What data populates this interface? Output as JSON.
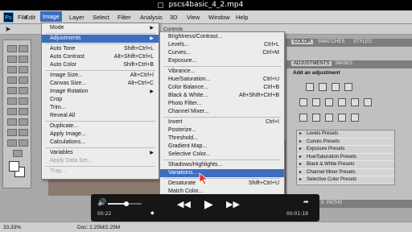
{
  "window": {
    "title": "pscs4basic_4_2.mp4"
  },
  "app": {
    "logo": "Ps"
  },
  "menubar": {
    "items": [
      "File",
      "Edit",
      "Image",
      "Layer",
      "Select",
      "Filter",
      "Analysis",
      "3D",
      "View",
      "Window",
      "Help"
    ],
    "active": "Image"
  },
  "optionsbar": {
    "controls_label": "Controls"
  },
  "image_menu": [
    {
      "label": "Mode",
      "type": "submenu"
    },
    {
      "type": "separator"
    },
    {
      "label": "Adjustments",
      "type": "submenu",
      "highlighted": true
    },
    {
      "type": "separator"
    },
    {
      "label": "Auto Tone",
      "shortcut": "Shift+Ctrl+L"
    },
    {
      "label": "Auto Contrast",
      "shortcut": "Alt+Shift+Ctrl+L"
    },
    {
      "label": "Auto Color",
      "shortcut": "Shift+Ctrl+B"
    },
    {
      "type": "separator"
    },
    {
      "label": "Image Size...",
      "shortcut": "Alt+Ctrl+I"
    },
    {
      "label": "Canvas Size...",
      "shortcut": "Alt+Ctrl+C"
    },
    {
      "label": "Image Rotation",
      "type": "submenu"
    },
    {
      "label": "Crop"
    },
    {
      "label": "Trim..."
    },
    {
      "label": "Reveal All"
    },
    {
      "type": "separator"
    },
    {
      "label": "Duplicate..."
    },
    {
      "label": "Apply Image..."
    },
    {
      "label": "Calculations..."
    },
    {
      "type": "separator"
    },
    {
      "label": "Variables",
      "type": "submenu"
    },
    {
      "label": "Apply Data Set...",
      "disabled": true
    },
    {
      "type": "separator"
    },
    {
      "label": "Trap...",
      "disabled": true
    }
  ],
  "adjustments_menu": [
    {
      "label": "Brightness/Contrast..."
    },
    {
      "label": "Levels...",
      "shortcut": "Ctrl+L"
    },
    {
      "label": "Curves...",
      "shortcut": "Ctrl+M"
    },
    {
      "label": "Exposure..."
    },
    {
      "type": "separator"
    },
    {
      "label": "Vibrance..."
    },
    {
      "label": "Hue/Saturation...",
      "shortcut": "Ctrl+U"
    },
    {
      "label": "Color Balance...",
      "shortcut": "Ctrl+B"
    },
    {
      "label": "Black & White...",
      "shortcut": "Alt+Shift+Ctrl+B"
    },
    {
      "label": "Photo Filter..."
    },
    {
      "label": "Channel Mixer..."
    },
    {
      "type": "separator"
    },
    {
      "label": "Invert",
      "shortcut": "Ctrl+I"
    },
    {
      "label": "Posterize..."
    },
    {
      "label": "Threshold..."
    },
    {
      "label": "Gradient Map..."
    },
    {
      "label": "Selective Color..."
    },
    {
      "type": "separator"
    },
    {
      "label": "Shadows/Highlights..."
    },
    {
      "label": "Variations...",
      "highlighted": true
    },
    {
      "type": "separator"
    },
    {
      "label": "Desaturate",
      "shortcut": "Shift+Ctrl+U"
    },
    {
      "label": "Match Color..."
    }
  ],
  "right_panel": {
    "top_tabs": [
      "COLOR",
      "SWATCHES",
      "STYLES"
    ],
    "adj_tabs": [
      "ADJUSTMENTS",
      "MASKS"
    ],
    "heading": "Add an adjustment",
    "presets": [
      "Levels Presets",
      "Curves Presets",
      "Exposure Presets",
      "Hue/Saturation Presets",
      "Black & White Presets",
      "Channel Mixer Presets",
      "Selective Color Presets"
    ],
    "bottom_tabs": [
      "CHANNELS",
      "PATHS"
    ]
  },
  "statusbar": {
    "zoom": "33.33%",
    "doc": "Doc: 2.25M/2.25M"
  },
  "player": {
    "current_time": "00:22",
    "remaining_time": "00:01:19",
    "volume": 0.55,
    "progress": 0.22
  },
  "colors": {
    "highlight": "#3d6dbf",
    "menubar": "#d4d4d4",
    "panel_bg": "#c0c0c0"
  }
}
